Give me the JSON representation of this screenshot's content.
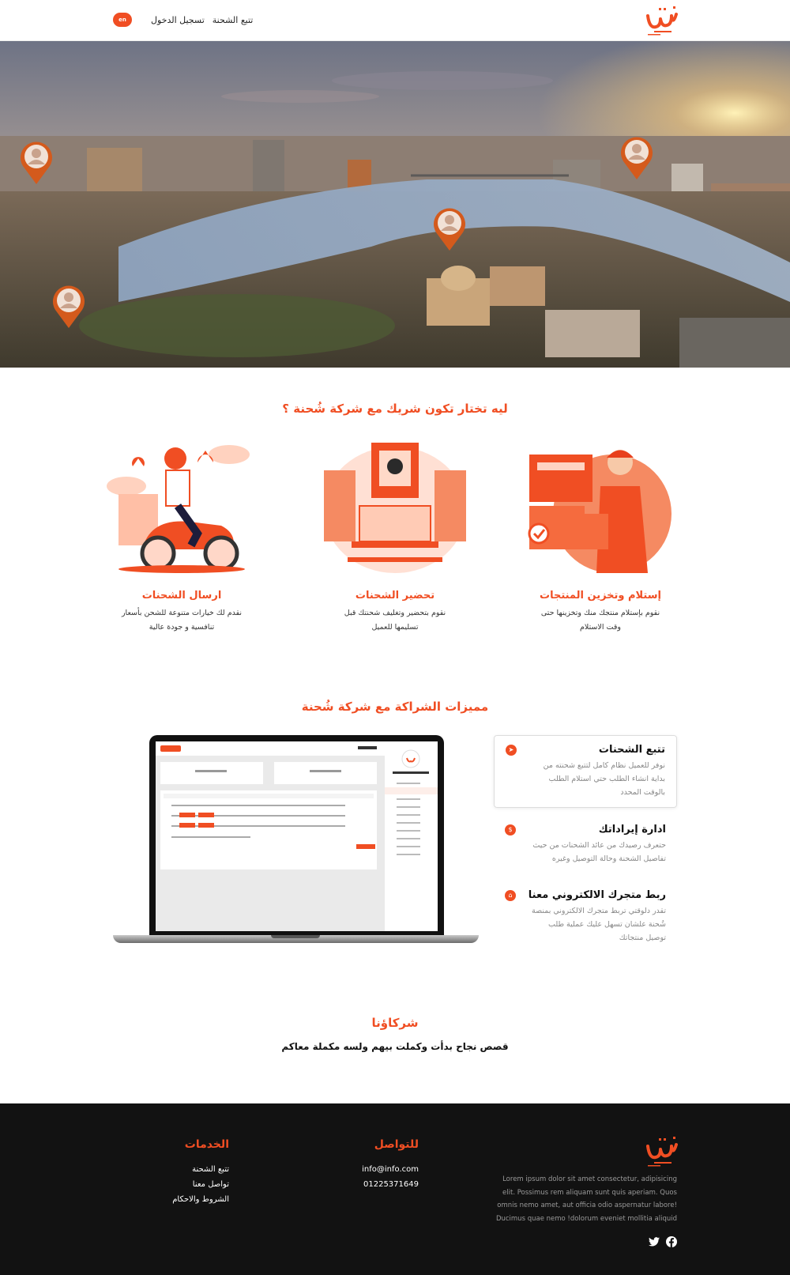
{
  "nav": {
    "lang_label": "en",
    "login_label": "تسجيل الدخول",
    "track_label": "تتبع الشحنة"
  },
  "why": {
    "title": "ليه تختار تكون شريك مع شركة شُحنة ؟",
    "items": [
      {
        "title": "إستلام وتخزين المنتجات",
        "desc": "نقوم بإستلام منتجك منك وتخزينها حتى وقت الاستلام"
      },
      {
        "title": "تحضير الشحنات",
        "desc": "نقوم بتحضير وتغليف شحنتك قبل تسليمها للعميل"
      },
      {
        "title": "ارسال الشحنات",
        "desc": "نقدم لك خيارات متنوعة للشحن بأسعار تنافسية و جودة عالية"
      }
    ]
  },
  "features": {
    "title": "مميزات الشراكة مع شركة شُحنة",
    "items": [
      {
        "title": "تتبع الشحنات",
        "desc": "نوفر للعميل نظام كامل لتتبع شحنته من بداية انشاء الطلب حتي استلام الطلب بالوقت المحدد",
        "icon": "compass-icon"
      },
      {
        "title": "ادارة إيراداتك",
        "desc": "حتعرف رصيدك من عائد الشحنات من حيث تفاصيل الشحنة وحالة التوصيل وغيره",
        "icon": "dollar-icon"
      },
      {
        "title": "ربط متجرك الالكتروني معنا",
        "desc": "تقدر دلوقتي تربط متجرك الالكتروني بمنصة شُحنة علشان تسهل عليك عملية طلب توصيل منتجاتك",
        "icon": "store-icon"
      }
    ]
  },
  "partners": {
    "title": "شركاؤنا",
    "subtitle": "قصص نجاح بدأت وكملت بيهم ولسه مكملة معاكم"
  },
  "footer": {
    "about": "Lorem ipsum dolor sit amet consectetur, adipisicing elit. Possimus rem aliquam sunt quis aperiam. Quos omnis nemo amet, aut officia odio aspernatur labore! Ducimus quae nemo !dolorum eveniet mollitia aliquid",
    "contact_title": "للتواصل",
    "email": "info@info.com",
    "phone": "01225371649",
    "services_title": "الخدمات",
    "services": [
      "تتبع الشحنة",
      "تواصل معنا",
      "الشروط والاحكام"
    ]
  },
  "colors": {
    "accent": "#f04e23",
    "footer_bg": "#121212"
  }
}
